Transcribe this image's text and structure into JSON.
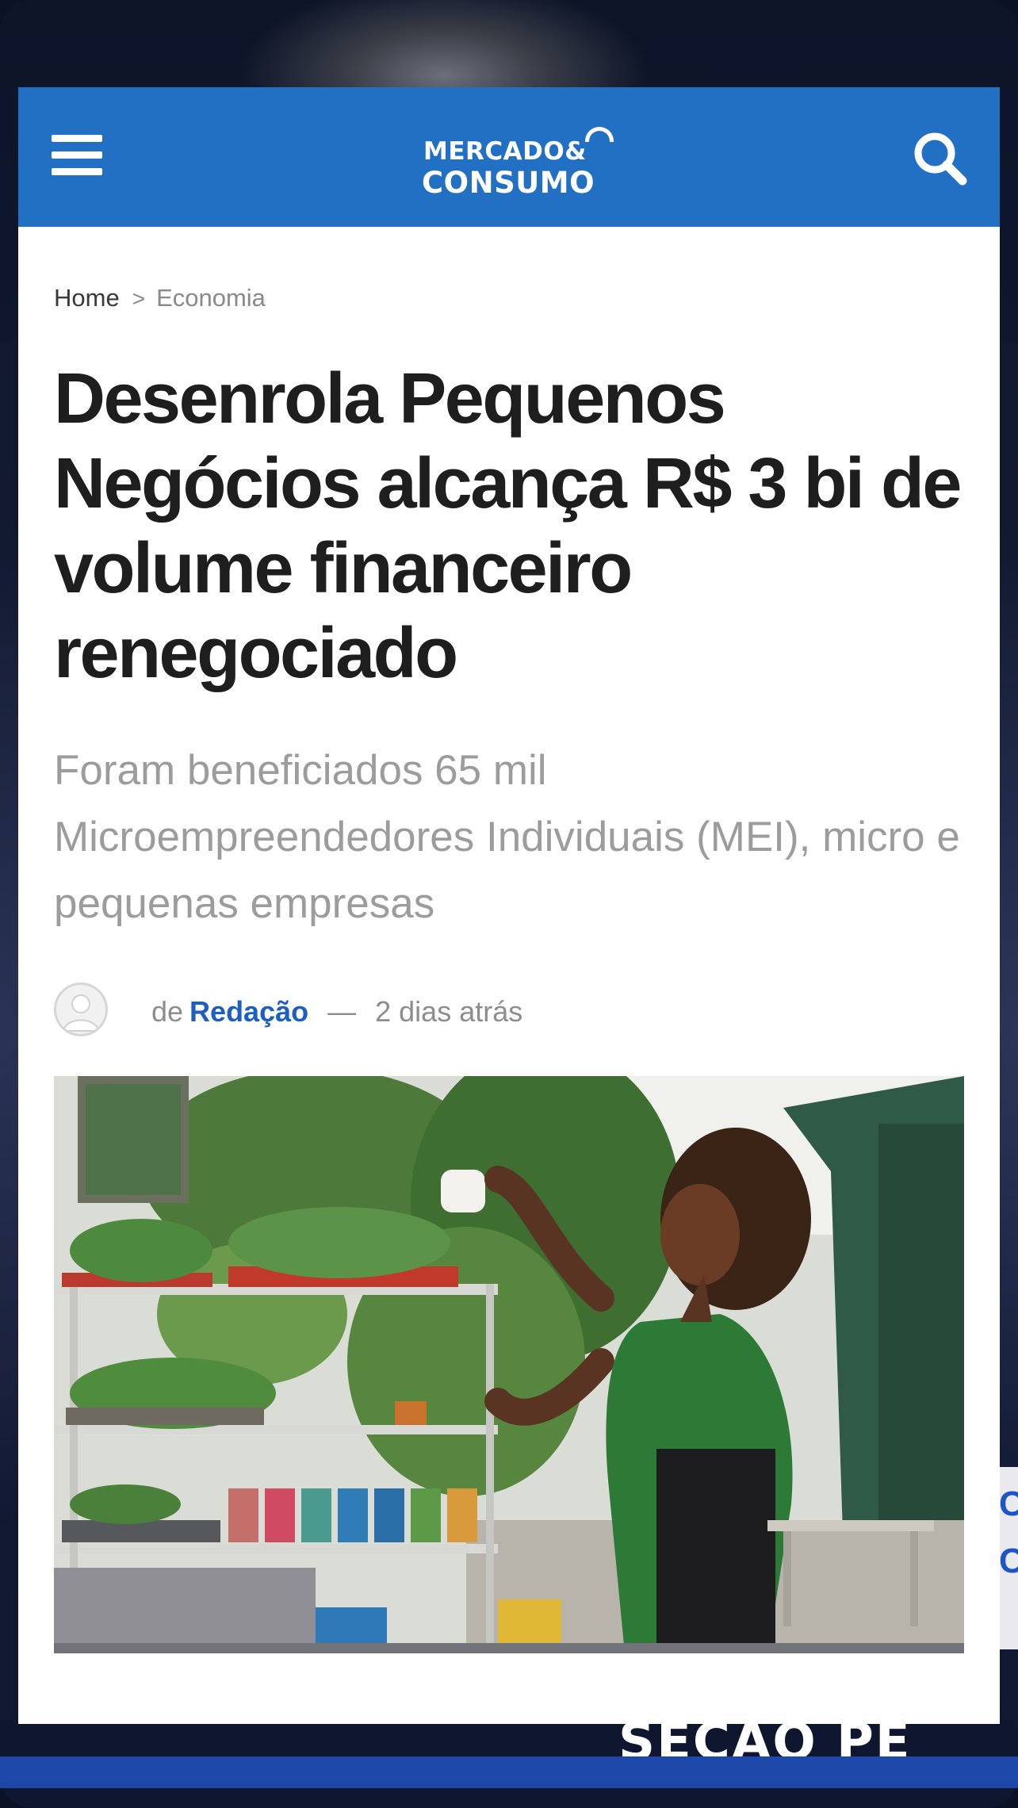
{
  "brand": {
    "logo_line1": "MERCADO&",
    "logo_line2": "CONSUMO",
    "bar_color": "#2170C4"
  },
  "nav": {
    "menu_icon": "hamburger-menu-icon",
    "search_icon": "search-icon"
  },
  "breadcrumb": {
    "home": "Home",
    "separator": ">",
    "current": "Economia"
  },
  "article": {
    "headline": "Desenrola Pequenos Negócios alcança R$ 3 bi de volume financeiro renegociado",
    "subtitle": "Foram beneficiados 65 mil Microempreendedores Individuais (MEI), micro e pequenas empresas",
    "byline_prefix": "de",
    "author": "Redação",
    "byline_separator": "—",
    "time_ago": "2 dias atrás",
    "author_color": "#1D5FC0"
  }
}
